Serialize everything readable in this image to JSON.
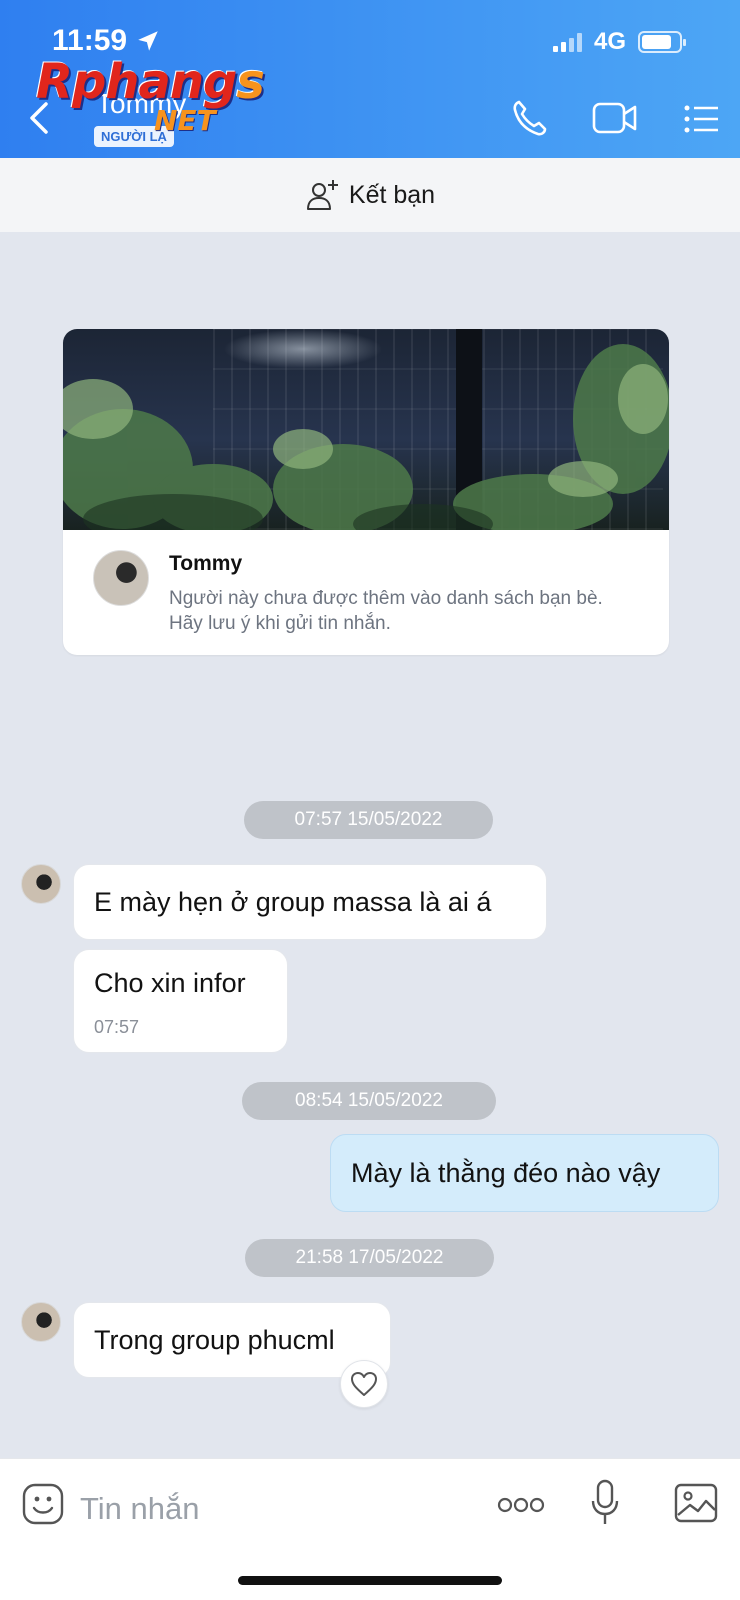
{
  "status_bar": {
    "time": "11:59",
    "network": "4G"
  },
  "header": {
    "contact_name": "Tommy",
    "badge": "NGƯỜI LẠ",
    "watermark_main": "Rphang",
    "watermark_s": "s",
    "watermark_sub": "NET",
    "icons": [
      "back-icon",
      "phone-icon",
      "video-call-icon",
      "menu-icon"
    ],
    "gradient": [
      "#2f7ff0",
      "#4da6f5"
    ]
  },
  "add_friend": {
    "label": "Kết bạn"
  },
  "profile_card": {
    "name": "Tommy",
    "description": "Người này chưa được thêm vào danh sách bạn bè. Hãy lưu ý khi gửi tin nhắn."
  },
  "messages": {
    "date1": "07:57 15/05/2022",
    "m1": "E mày hẹn ở group massa là ai á",
    "m2": "Cho xin infor",
    "m2_time": "07:57",
    "date2": "08:54 15/05/2022",
    "m3": "Mày là thằng đéo nào vậy",
    "date3": "21:58 17/05/2022",
    "m4": "Trong group phucml"
  },
  "composer": {
    "placeholder": "Tin nhắn",
    "icons": [
      "sticker-icon",
      "more-icon",
      "microphone-icon",
      "image-icon"
    ]
  },
  "colors": {
    "chat_bg": "#e2e6ee",
    "sent_bubble": "#d4ecfb",
    "time_pill": "#bfc3c9"
  }
}
